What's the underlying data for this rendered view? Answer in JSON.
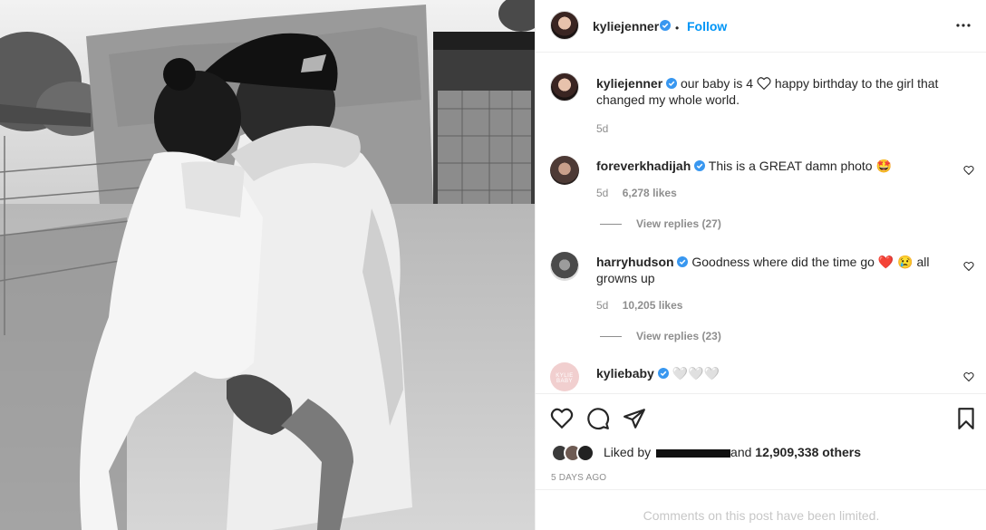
{
  "post": {
    "photo_alt": "",
    "header": {
      "username": "kyliejenner",
      "separator": "•",
      "follow_label": "Follow",
      "more_icon": "more-horizontal-icon"
    },
    "caption": {
      "username": "kyliejenner",
      "text_before": "our baby is 4",
      "text_after": "happy birthday to the girl that changed my whole world.",
      "time": "5d"
    },
    "comments": [
      {
        "username": "foreverkhadijah",
        "text": "This is a GREAT damn photo 🤩",
        "time": "5d",
        "likes": "6,278 likes",
        "view_replies": "View replies (27)"
      },
      {
        "username": "harryhudson",
        "text_before": "Goodness where did the time go",
        "text_after": "all grownups up",
        "text_display": "Goodness where did the time go ❤️ 😢 all growns up",
        "time": "5d",
        "likes": "10,205 likes",
        "view_replies": "View replies (23)"
      },
      {
        "username": "kyliebaby",
        "text": "🤍🤍🤍",
        "avatar_label": "KYLIE BABY"
      }
    ],
    "actions": {
      "like_icon": "heart-icon",
      "comment_icon": "comment-icon",
      "share_icon": "send-icon",
      "save_icon": "bookmark-icon"
    },
    "liked_by": {
      "prefix": "Liked by",
      "connector": "and",
      "count": "12,909,338 others"
    },
    "timestamp": "5 DAYS AGO",
    "comments_limited": "Comments on this post have been limited."
  },
  "colors": {
    "accent": "#0095f6",
    "verified": "#3897f0",
    "muted": "#8e8e8e",
    "text": "#262626"
  }
}
